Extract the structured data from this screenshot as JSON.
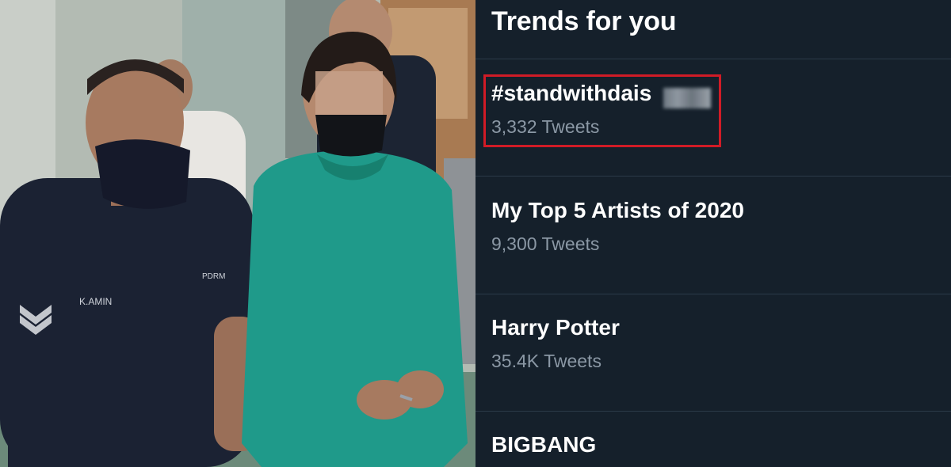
{
  "trends": {
    "title": "Trends for you",
    "items": [
      {
        "name": "#standwithdais",
        "count": "3,332 Tweets"
      },
      {
        "name": "My Top 5 Artists of 2020",
        "count": "9,300 Tweets"
      },
      {
        "name": "Harry Potter",
        "count": "35.4K Tweets"
      },
      {
        "name": "BIGBANG"
      }
    ]
  },
  "photo": {
    "uniform_text_left": "PDRM",
    "uniform_name_tag": "K.AMIN"
  },
  "colors": {
    "background": "#15202b",
    "secondary_text": "#8b98a5",
    "highlight_border": "#d11b26",
    "kurta": "#1f9a8a",
    "uniform": "#1b2233"
  }
}
